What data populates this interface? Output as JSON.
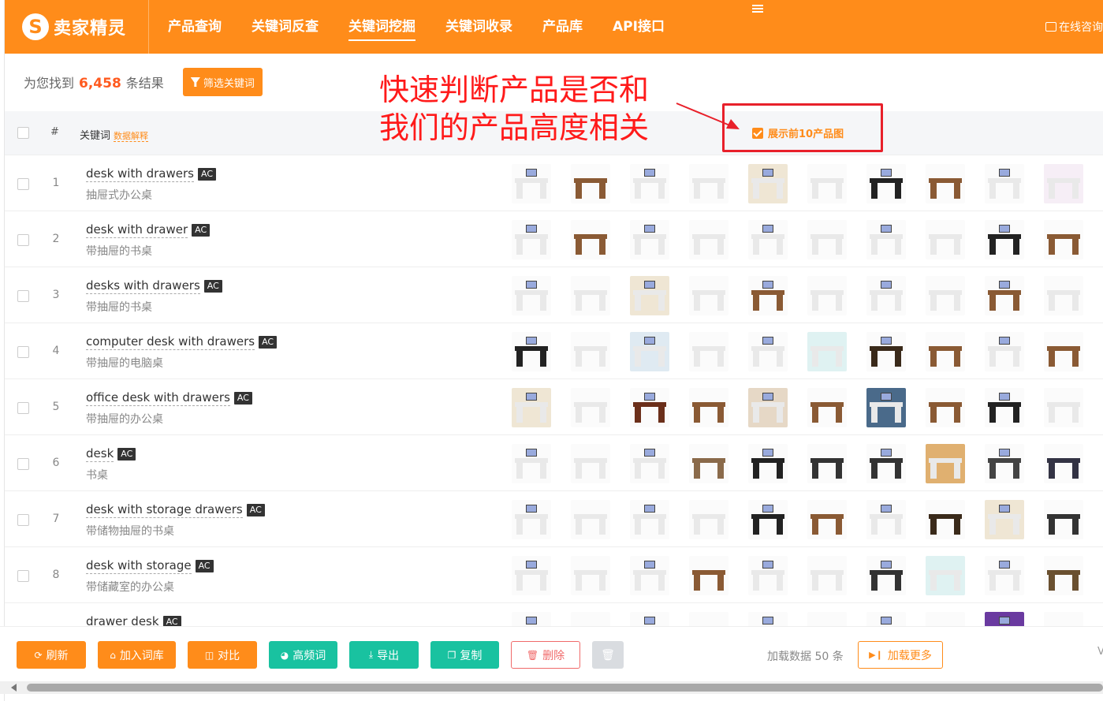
{
  "header": {
    "logo_mark": "S",
    "logo_text": "卖家精灵",
    "nav": [
      {
        "label": "产品查询",
        "active": false
      },
      {
        "label": "关键词反查",
        "active": false
      },
      {
        "label": "关键词挖掘",
        "active": true
      },
      {
        "label": "关键词收录",
        "active": false
      },
      {
        "label": "产品库",
        "active": false
      },
      {
        "label": "API接口",
        "active": false
      }
    ],
    "consult_label": "在线咨询"
  },
  "results": {
    "prefix": "为您找到",
    "count": "6,458",
    "suffix": "条结果",
    "filter_label": "筛选关键词"
  },
  "annotation": {
    "line1": "快速判断产品是否和",
    "line2": "我们的产品高度相关"
  },
  "show_top10_label": "展示前10产品图",
  "table": {
    "col_num": "#",
    "col_keyword": "关键词",
    "col_keyword_help": "数据解释",
    "rows": [
      {
        "num": "1",
        "keyword": "desk with drawers",
        "badge": "AC",
        "cn": "抽屉式办公桌"
      },
      {
        "num": "2",
        "keyword": "desk with drawer",
        "badge": "AC",
        "cn": "带抽屉的书桌"
      },
      {
        "num": "3",
        "keyword": "desks with drawers",
        "badge": "AC",
        "cn": "带抽屉的书桌"
      },
      {
        "num": "4",
        "keyword": "computer desk with drawers",
        "badge": "AC",
        "cn": "带抽屉的电脑桌"
      },
      {
        "num": "5",
        "keyword": "office desk with drawers",
        "badge": "AC",
        "cn": "带抽屉的办公桌"
      },
      {
        "num": "6",
        "keyword": "desk",
        "badge": "AC",
        "cn": "书桌"
      },
      {
        "num": "7",
        "keyword": "desk with storage drawers",
        "badge": "AC",
        "cn": "带储物抽屉的书桌"
      },
      {
        "num": "8",
        "keyword": "desk with storage",
        "badge": "AC",
        "cn": "带储藏室的办公桌"
      },
      {
        "num": "",
        "keyword": "drawer desk",
        "badge": "AC",
        "cn": ""
      }
    ]
  },
  "toolbar": {
    "refresh": "刷新",
    "add_to_lib": "加入词库",
    "compare": "对比",
    "high_freq": "高频词",
    "export": "导出",
    "copy": "复制",
    "delete": "删除",
    "load_info": "加载数据 50 条",
    "load_more": "加载更多",
    "edge_char": "V"
  },
  "colors": {
    "brand": "#ff8c1a",
    "green": "#19c2a0",
    "annotation_red": "#ff1a1a",
    "highlight_box": "#e8202a"
  },
  "thumb_palettes": [
    [
      "#f2f2f2",
      "#8a5a34",
      "#f2f2f2",
      "#e8e8e8",
      "#efe6d4",
      "#f4f4f4",
      "#222",
      "#8a5a34",
      "#eee",
      "#f6eef6"
    ],
    [
      "#f2f2f2",
      "#8a5a34",
      "#f2f2f2",
      "#eee",
      "#f2f2f2",
      "#f4f4f4",
      "#f2f2f2",
      "#f2f2f2",
      "#222",
      "#8a5a34"
    ],
    [
      "#f2f2f2",
      "#eee",
      "#efe6d4",
      "#f2f2f2",
      "#8a5a34",
      "#f2f2f2",
      "#f2f2f2",
      "#f2f2f2",
      "#8a5a34",
      "#f4f4f4"
    ],
    [
      "#222",
      "#f2f2f2",
      "#dfeaf2",
      "#f2f2f2",
      "#f2f2f2",
      "#dff2f2",
      "#3a2a1a",
      "#8a5a34",
      "#f2f2f2",
      "#8a5a34"
    ],
    [
      "#efe6d4",
      "#f2f2f2",
      "#6b2f1a",
      "#8a5a34",
      "#e6d8c6",
      "#8a5a34",
      "#4a6a8a",
      "#8a5a34",
      "#222",
      "#f2f2f2"
    ],
    [
      "#f6f6f6",
      "#f6f6f6",
      "#fafafa",
      "#8a6a4a",
      "#222",
      "#333",
      "#333",
      "#e0b070",
      "#444",
      "#334"
    ],
    [
      "#f2f2f2",
      "#f2f2f2",
      "#f2f2f2",
      "#f2f2f2",
      "#222",
      "#8a5a34",
      "#f2f2f2",
      "#3a2a1a",
      "#efe6d4",
      "#333"
    ],
    [
      "#f2f2f2",
      "#f2f2f2",
      "#f6f0e6",
      "#8a5a34",
      "#f2f2f2",
      "#f2f2f2",
      "#333",
      "#dff2f2",
      "#f2f2f2",
      "#6a5030"
    ],
    [
      "#222",
      "#f6f6f6",
      "#3a2a1a",
      "#8a5a34",
      "#8a5a34",
      "#f2f2f2",
      "#8a5a34",
      "#f2f2f2",
      "#6a3aa0",
      "#333"
    ]
  ]
}
